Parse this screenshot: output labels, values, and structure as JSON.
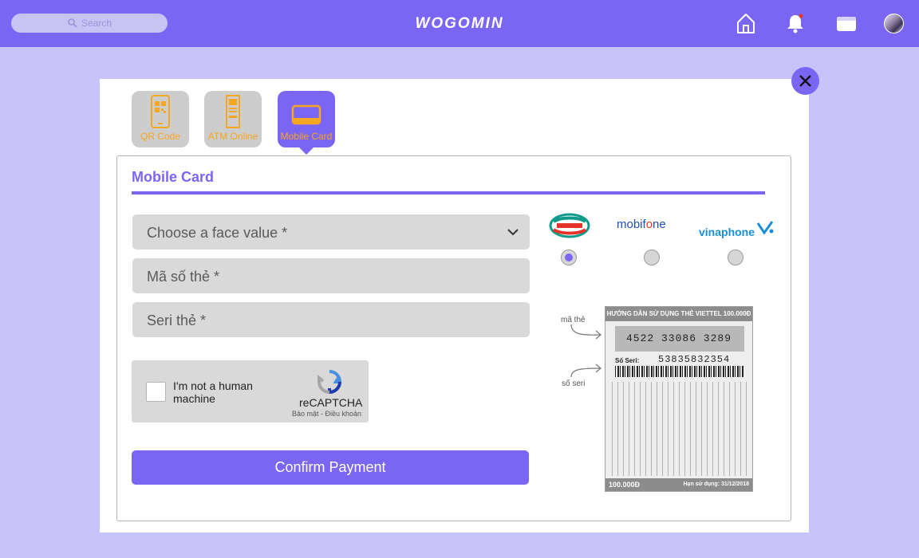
{
  "header": {
    "search_placeholder": "Search",
    "logo": "WOGOMIN",
    "icons": [
      "home-icon",
      "bell-icon",
      "wallet-icon",
      "avatar"
    ]
  },
  "tabs": [
    {
      "label": "QR Code",
      "icon": "qr-phone-icon",
      "active": false
    },
    {
      "label": "ATM Online",
      "icon": "atm-icon",
      "active": false
    },
    {
      "label": "Mobile Card",
      "icon": "laptop-card-icon",
      "active": true
    }
  ],
  "panel": {
    "title": "Mobile Card",
    "fields": {
      "face_value": "Choose a face value *",
      "card_code": "Mã số thẻ *",
      "serial": "Seri thẻ *"
    },
    "captcha": {
      "label": "I'm not a human machine",
      "brand": "reCAPTCHA",
      "terms": "Bảo mật - Điều khoản"
    },
    "confirm_label": "Confirm Payment"
  },
  "carriers": [
    {
      "name": "viettel",
      "selected": true
    },
    {
      "name": "mobifone",
      "selected": false
    },
    {
      "name": "vinaphone",
      "selected": false
    }
  ],
  "card_example": {
    "hint_code": "mã thẻ",
    "hint_serial": "số seri",
    "header": "HƯỚNG DẪN SỬ DỤNG THẺ VIETTEL 100.000Đ",
    "code": "4522 33086 3289",
    "serial_label": "Số Seri:",
    "serial": "53835832354",
    "value": "100.000Đ",
    "expiry": "Hạn sử dụng: 31/12/2018"
  },
  "colors": {
    "accent": "#7b66f4",
    "background": "#c9c3fb",
    "tab_label": "#f5a623"
  }
}
